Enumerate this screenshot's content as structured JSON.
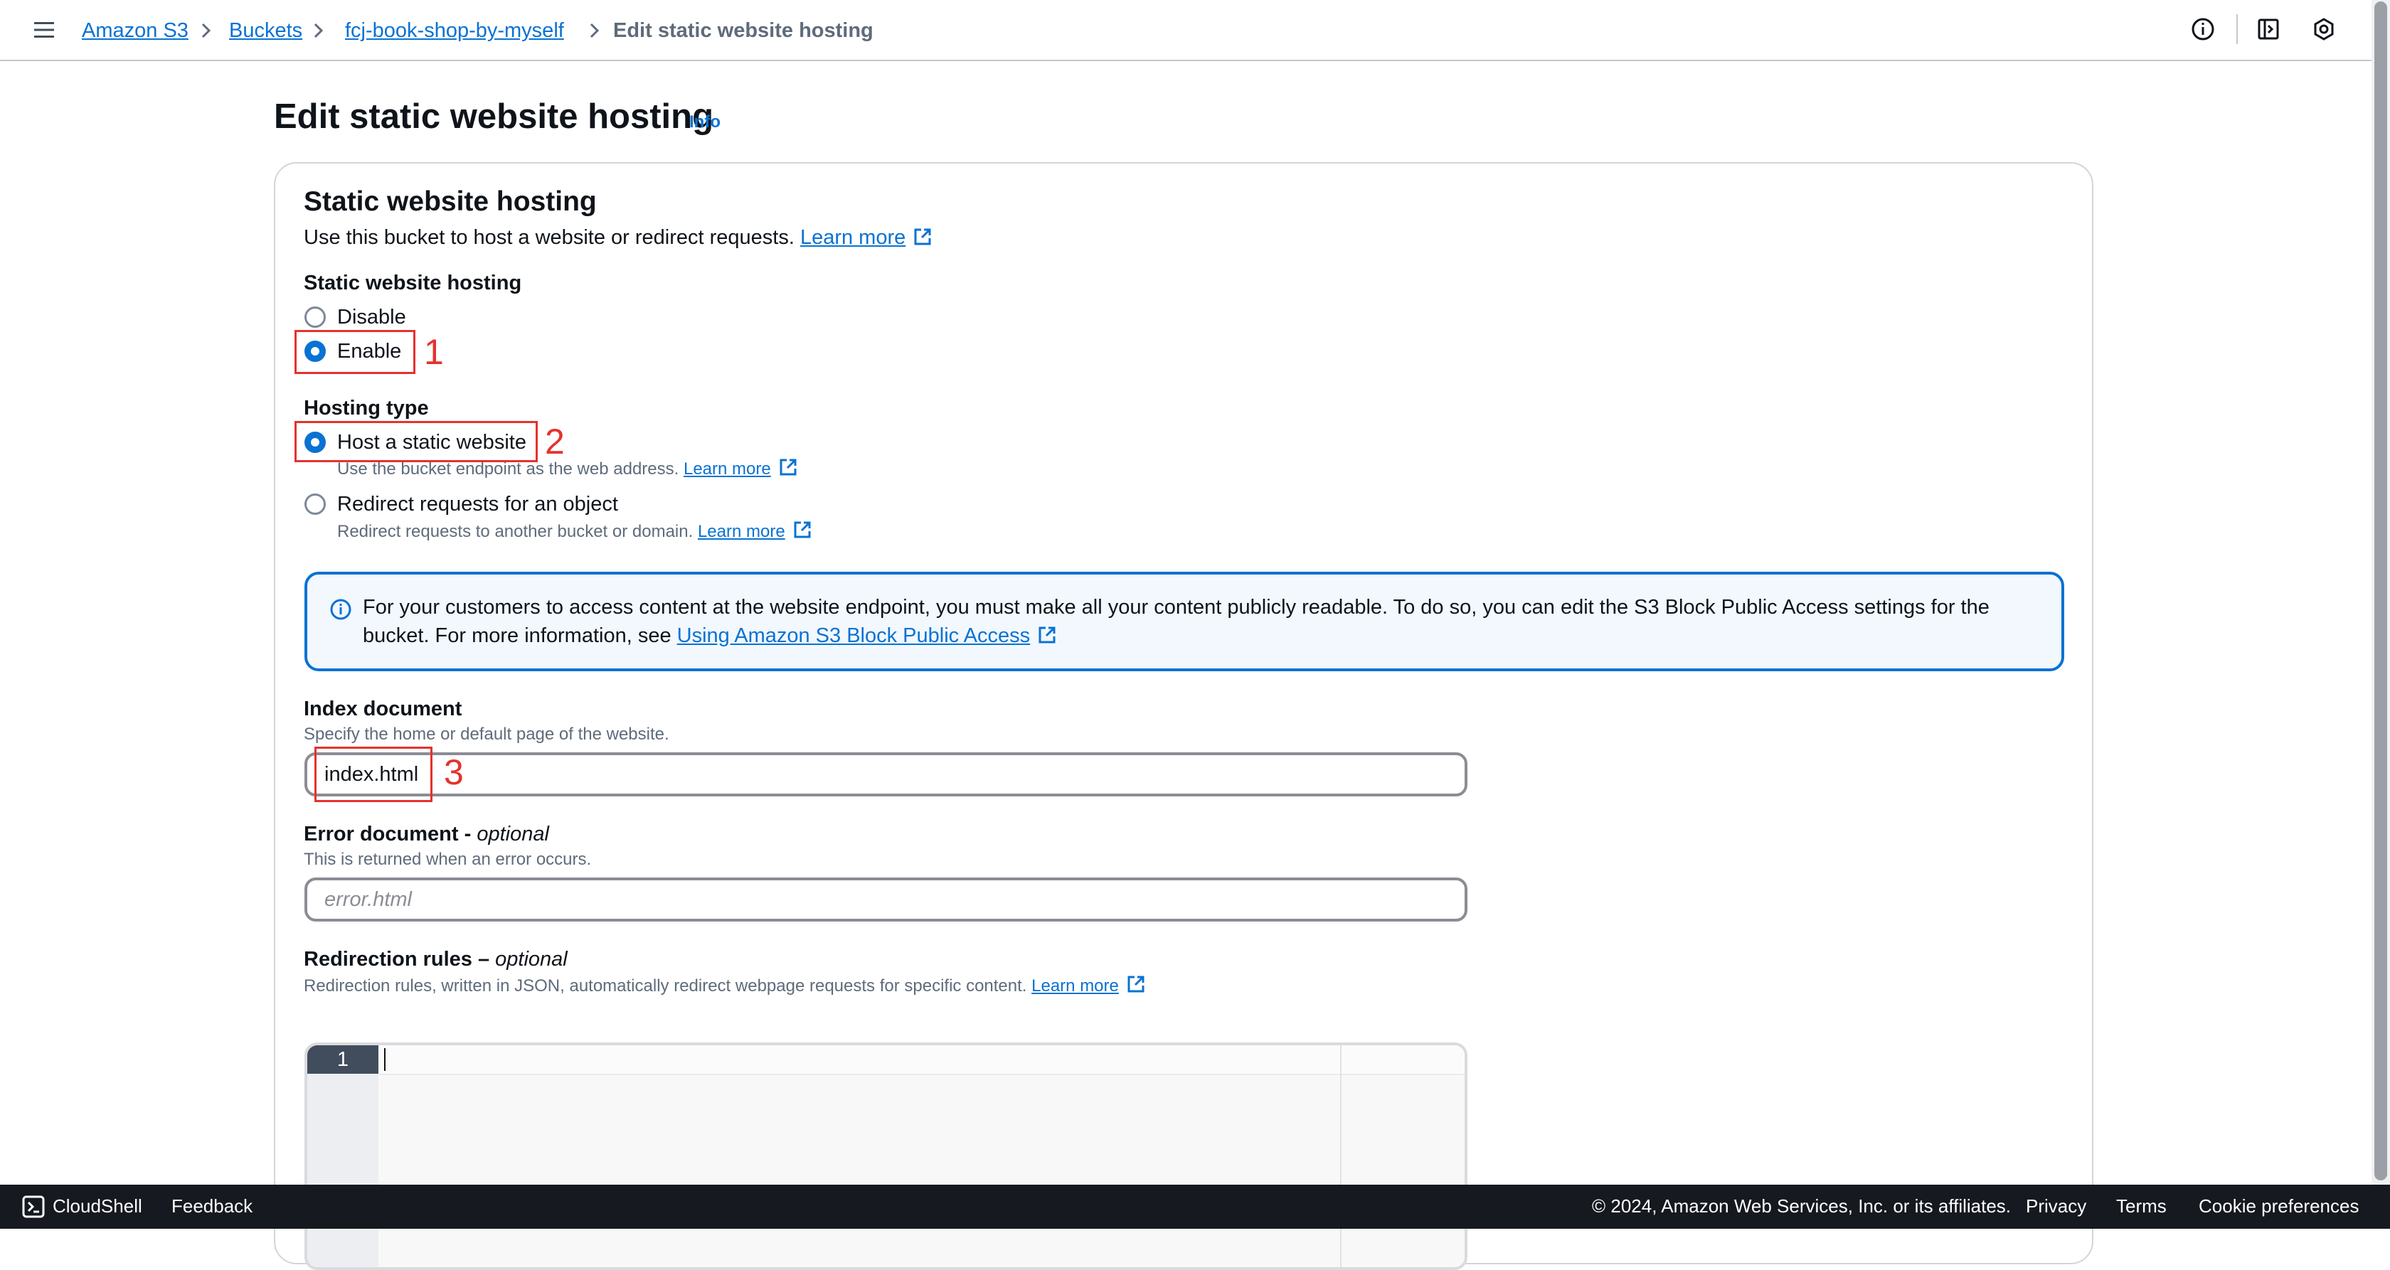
{
  "breadcrumb": {
    "items": [
      "Amazon S3",
      "Buckets",
      "fcj-book-shop-by-myself"
    ],
    "current": "Edit static website hosting"
  },
  "page": {
    "title": "Edit static website hosting",
    "info_link": "Info"
  },
  "section": {
    "title": "Static website hosting",
    "description": "Use this bucket to host a website or redirect requests.",
    "learn_more": "Learn more"
  },
  "hosting": {
    "label": "Static website hosting",
    "options": [
      "Disable",
      "Enable"
    ],
    "selected": "Enable"
  },
  "hosting_type": {
    "label": "Hosting type",
    "options": [
      {
        "label": "Host a static website",
        "description": "Use the bucket endpoint as the web address.",
        "link": "Learn more"
      },
      {
        "label": "Redirect requests for an object",
        "description": "Redirect requests to another bucket or domain.",
        "link": "Learn more"
      }
    ],
    "selected": "Host a static website"
  },
  "info_alert": {
    "line1": "For your customers to access content at the website endpoint, you must make all your content publicly readable. To do so, you can edit the S3 Block Public Access settings for the",
    "line2": "bucket. For more information, see",
    "link": "Using Amazon S3 Block Public Access"
  },
  "index_document": {
    "label": "Index document",
    "description": "Specify the home or default page of the website.",
    "value": "index.html"
  },
  "error_document": {
    "label": "Error document -",
    "label_suffix": "optional",
    "description": "This is returned when an error occurs.",
    "placeholder": "error.html",
    "value": ""
  },
  "redirection_rules": {
    "label": "Redirection rules –",
    "label_suffix": "optional",
    "description": "Redirection rules, written in JSON, automatically redirect webpage requests for specific content.",
    "link": "Learn more",
    "line_number": "1"
  },
  "annotations": [
    "1",
    "2",
    "3"
  ],
  "footer": {
    "cloudshell": "CloudShell",
    "feedback": "Feedback",
    "copyright": "© 2024, Amazon Web Services, Inc. or its affiliates.",
    "privacy": "Privacy",
    "terms": "Terms",
    "cookie": "Cookie preferences"
  },
  "icons": [
    "menu-icon",
    "chevron-right-icon",
    "info-circle-icon",
    "notifications-icon",
    "settings-icon",
    "external-link-icon",
    "cloudshell-icon"
  ],
  "colors": {
    "link": "#0972d3",
    "annotation_red": "#e5322d",
    "info_bg": "#f2f8fd",
    "footer_bg": "#16191f"
  }
}
